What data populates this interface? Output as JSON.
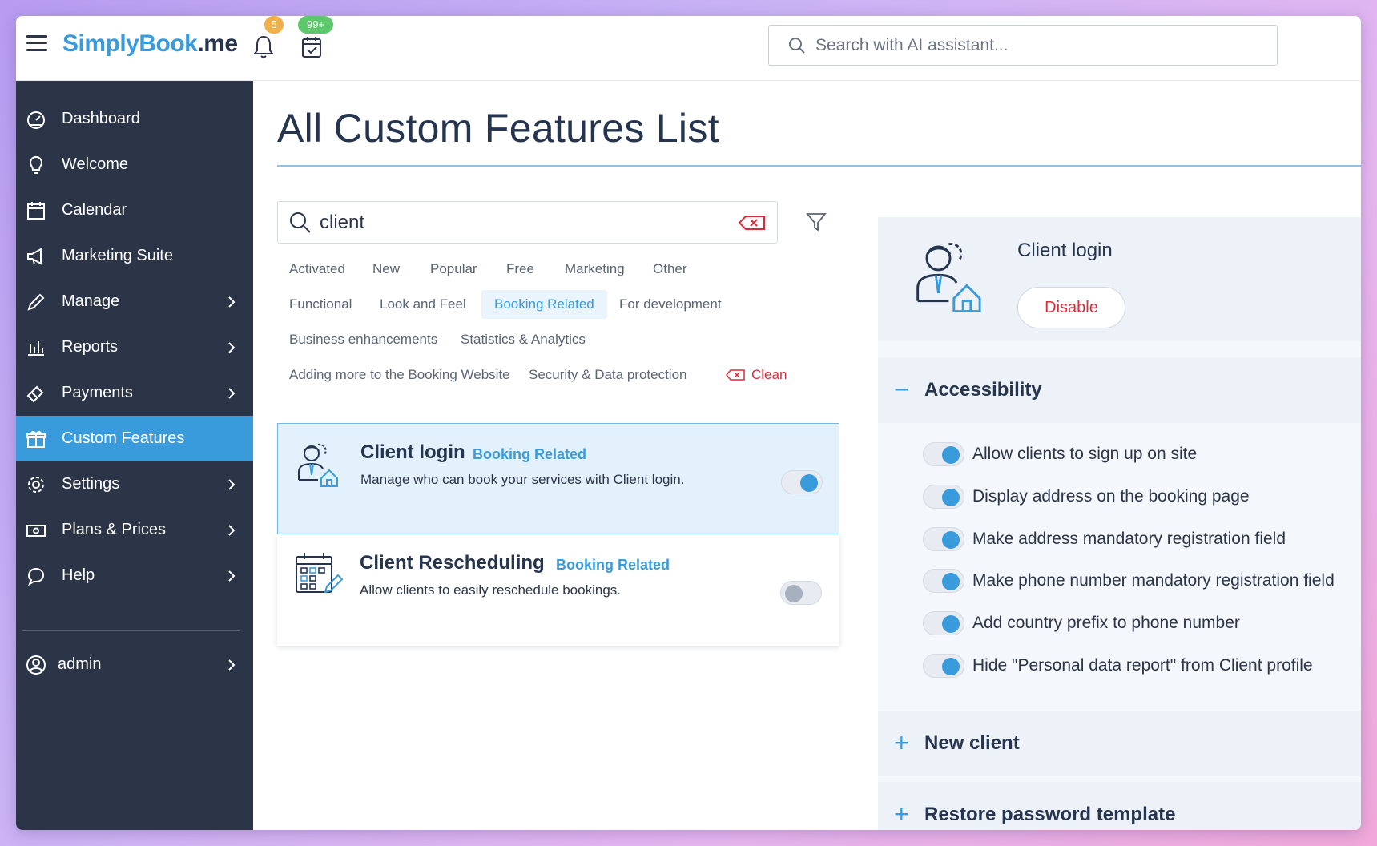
{
  "brand": {
    "logo_a": "S",
    "logo_b": "implyBook",
    "logo_c": ".me",
    "accent": "#3a9bdc",
    "sidebar_bg": "#2c3448"
  },
  "topbar": {
    "bell_badge": "5",
    "calendar_badge": "99+",
    "search_placeholder": "Search with AI assistant..."
  },
  "sidebar": {
    "items": [
      {
        "label": "Dashboard",
        "icon": "dashboard-icon",
        "chevron": false,
        "active": false
      },
      {
        "label": "Welcome",
        "icon": "lightbulb-icon",
        "chevron": false,
        "active": false
      },
      {
        "label": "Calendar",
        "icon": "calendar-icon",
        "chevron": false,
        "active": false
      },
      {
        "label": "Marketing Suite",
        "icon": "megaphone-icon",
        "chevron": false,
        "active": false
      },
      {
        "label": "Manage",
        "icon": "pencil-icon",
        "chevron": true,
        "active": false
      },
      {
        "label": "Reports",
        "icon": "bar-chart-icon",
        "chevron": true,
        "active": false
      },
      {
        "label": "Payments",
        "icon": "card-icon",
        "chevron": true,
        "active": false
      },
      {
        "label": "Custom Features",
        "icon": "gift-icon",
        "chevron": false,
        "active": true
      },
      {
        "label": "Settings",
        "icon": "gear-icon",
        "chevron": true,
        "active": false
      },
      {
        "label": "Plans & Prices",
        "icon": "money-icon",
        "chevron": true,
        "active": false
      },
      {
        "label": "Help",
        "icon": "chat-bubble-icon",
        "chevron": true,
        "active": false
      }
    ],
    "user_label": "admin"
  },
  "main": {
    "title": "All Custom Features List",
    "search_value": "client",
    "tags": [
      "Activated",
      "New",
      "Popular",
      "Free",
      "Marketing",
      "Other",
      "Functional",
      "Look and Feel",
      "Booking Related",
      "For development",
      "Business enhancements",
      "Statistics & Analytics",
      "Adding more to the Booking Website",
      "Security & Data protection"
    ],
    "selected_tag": "Booking Related",
    "clean_label": "Clean",
    "cards": [
      {
        "title": "Client login",
        "tag": "Booking Related",
        "description": "Manage who can book your services with Client login.",
        "enabled": true
      },
      {
        "title": "Client Rescheduling",
        "tag": "Booking Related",
        "description": "Allow clients to easily reschedule bookings.",
        "enabled": false
      }
    ]
  },
  "detail": {
    "title": "Client login",
    "disable_label": "Disable",
    "sections": [
      {
        "title": "Accessibility",
        "expanded": true,
        "sign": "−"
      },
      {
        "title": "New client",
        "expanded": false,
        "sign": "+"
      },
      {
        "title": "Restore password template",
        "expanded": false,
        "sign": "+"
      }
    ],
    "options": [
      {
        "label": "Allow clients to sign up on site",
        "enabled": true
      },
      {
        "label": "Display address on the booking page",
        "enabled": true
      },
      {
        "label": "Make address mandatory registration field",
        "enabled": true
      },
      {
        "label": "Make phone number mandatory registration field",
        "enabled": true
      },
      {
        "label": "Add country prefix to phone number",
        "enabled": true
      },
      {
        "label": "Hide \"Personal data report\" from Client profile",
        "enabled": true
      }
    ]
  }
}
